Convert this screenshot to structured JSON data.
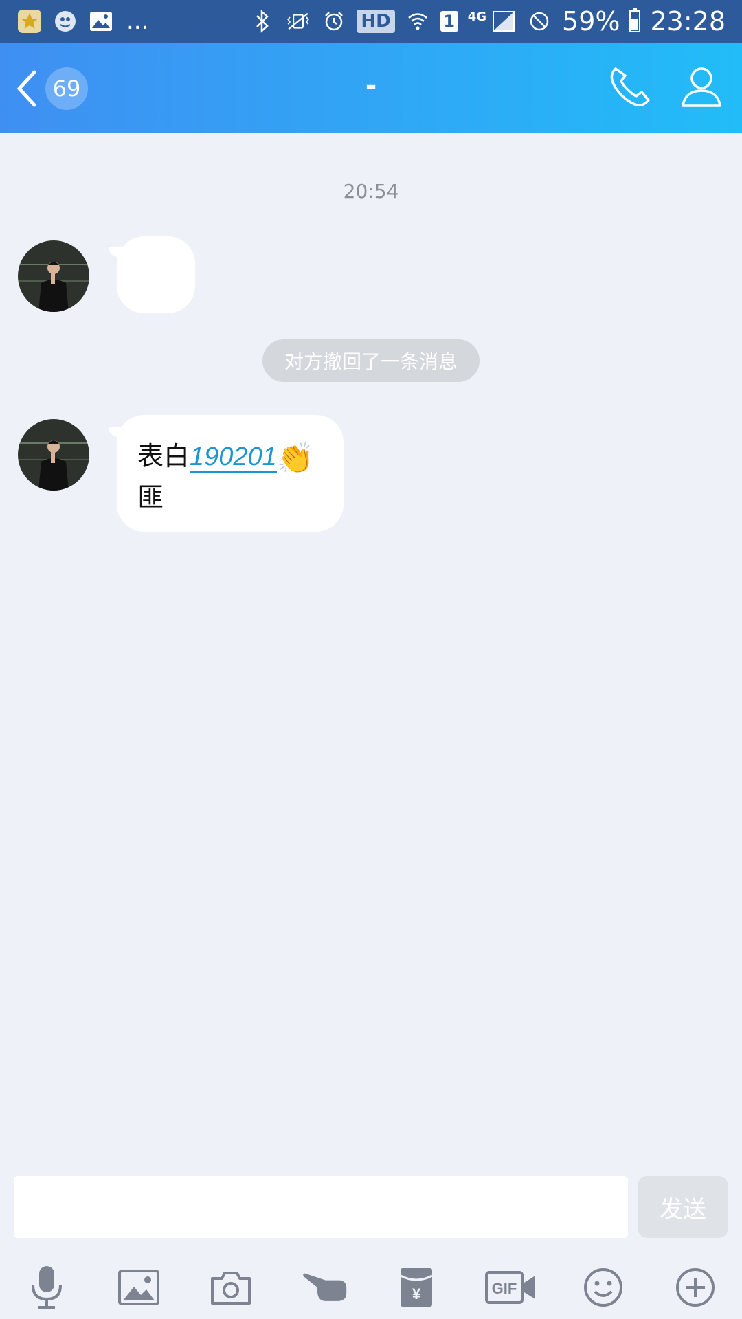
{
  "status_bar": {
    "dots": "...",
    "hd": "HD",
    "sim": "1",
    "network": "4G",
    "battery_percent": "59%",
    "battery_level": 0.59,
    "time": "23:28"
  },
  "header": {
    "unread_count": "69",
    "title": "-"
  },
  "chat": {
    "timestamp": "20:54",
    "recall_notice": "对方撤回了一条消息",
    "message": {
      "prefix": "表白",
      "number": "190201",
      "emoji": "👏",
      "suffix": "匪"
    }
  },
  "composer": {
    "input_value": "",
    "send_label": "发送"
  },
  "colors": {
    "header_start": "#3f8ff2",
    "header_end": "#22bcf8",
    "background": "#eef2f8",
    "link": "#1e95d0"
  },
  "icons": [
    "gold-star-app-icon",
    "qq-notify-icon",
    "image-notify-icon",
    "bluetooth-icon",
    "vibrate-mute-icon",
    "alarm-icon",
    "wifi-icon",
    "signal-icon",
    "dnd-icon",
    "battery-icon",
    "back-icon",
    "phone-icon",
    "profile-icon",
    "microphone-icon",
    "image-icon",
    "camera-icon",
    "poke-icon",
    "red-envelope-icon",
    "gif-icon",
    "emoji-icon",
    "plus-icon"
  ]
}
